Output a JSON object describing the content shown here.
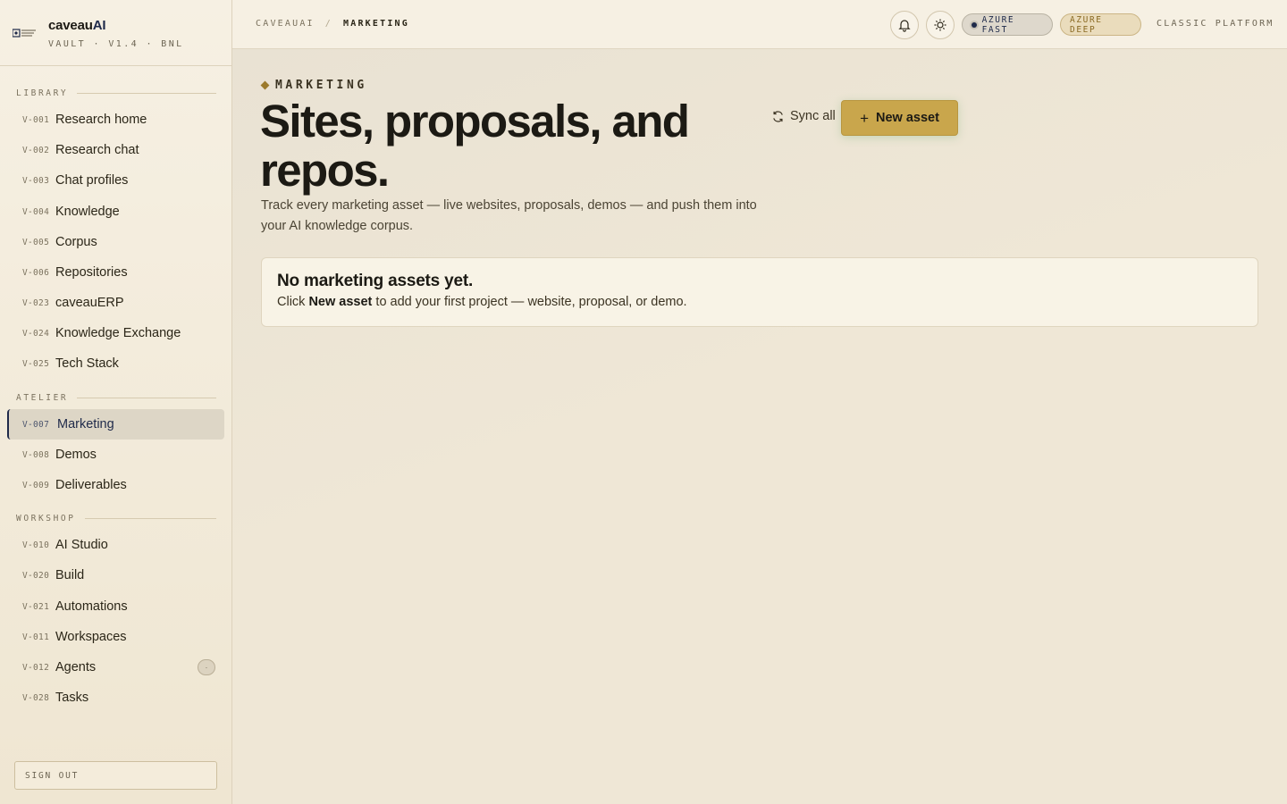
{
  "brand": {
    "name_main": "caveau",
    "name_accent": "AI",
    "subtitle": "VAULT · V1.4 · BNL",
    "logo_icon": "vault-logo-icon"
  },
  "sidebar": {
    "sections": [
      {
        "title": "LIBRARY",
        "items": [
          {
            "code": "V-001",
            "label": "Research home"
          },
          {
            "code": "V-002",
            "label": "Research chat"
          },
          {
            "code": "V-003",
            "label": "Chat profiles"
          },
          {
            "code": "V-004",
            "label": "Knowledge"
          },
          {
            "code": "V-005",
            "label": "Corpus"
          },
          {
            "code": "V-006",
            "label": "Repositories"
          },
          {
            "code": "V-023",
            "label": "caveauERP"
          },
          {
            "code": "V-024",
            "label": "Knowledge Exchange"
          },
          {
            "code": "V-025",
            "label": "Tech Stack"
          }
        ]
      },
      {
        "title": "ATELIER",
        "items": [
          {
            "code": "V-007",
            "label": "Marketing",
            "active": true
          },
          {
            "code": "V-008",
            "label": "Demos"
          },
          {
            "code": "V-009",
            "label": "Deliverables"
          }
        ]
      },
      {
        "title": "WORKSHOP",
        "items": [
          {
            "code": "V-010",
            "label": "AI Studio"
          },
          {
            "code": "V-020",
            "label": "Build"
          },
          {
            "code": "V-021",
            "label": "Automations"
          },
          {
            "code": "V-011",
            "label": "Workspaces"
          },
          {
            "code": "V-012",
            "label": "Agents",
            "badge": "·"
          },
          {
            "code": "V-028",
            "label": "Tasks"
          }
        ]
      }
    ],
    "signout_label": "SIGN OUT"
  },
  "topbar": {
    "breadcrumb": [
      "CAVEAUAI",
      "/",
      "MARKETING"
    ],
    "bell_icon": "bell-icon",
    "theme_icon": "sun-icon",
    "pill_fast": "AZURE FAST",
    "pill_deep": "AZURE DEEP",
    "classic_label": "CLASSIC PLATFORM"
  },
  "main": {
    "eyebrow": "MARKETING",
    "title": "Sites, proposals, and repos.",
    "subtitle": "Track every marketing asset — live websites, proposals, demos — and push them into your AI knowledge corpus.",
    "sync_label": "Sync all",
    "new_asset_label": "New asset",
    "empty": {
      "title": "No marketing assets yet.",
      "text_before": "Click ",
      "text_bold": "New asset",
      "text_after": " to add your first project — website, proposal, or demo."
    }
  },
  "colors": {
    "accent_gold": "#c9a64c",
    "navy": "#1f2a4a",
    "background": "#efe7d6"
  }
}
